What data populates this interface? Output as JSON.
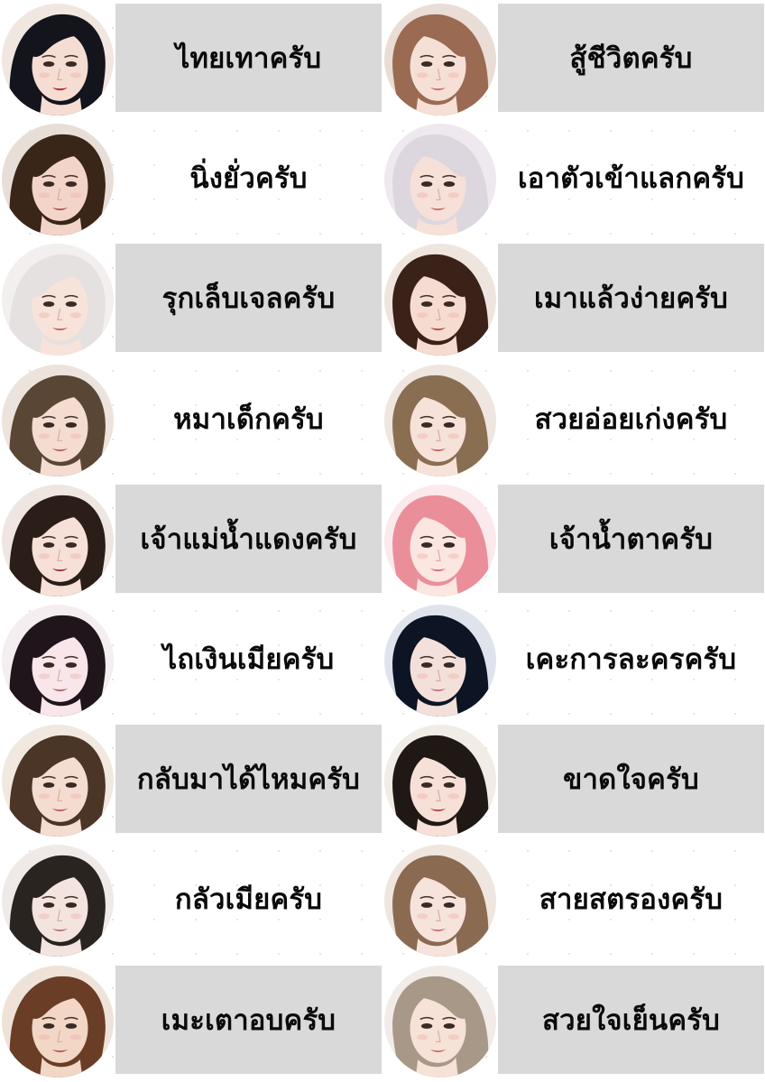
{
  "items": [
    {
      "label": "ไทยเทาครับ",
      "shaded": true,
      "icon": "avatar-icon",
      "hair": "#14141c",
      "bg": "#f1e6e0",
      "skin": "#f6ddd3",
      "lip": "#b21f2a"
    },
    {
      "label": "สู้ชีวิตครับ",
      "shaded": true,
      "icon": "avatar-icon",
      "hair": "#9a6a52",
      "bg": "#e9ddd6",
      "skin": "#f6e0d6",
      "lip": "#c86a6a"
    },
    {
      "label": "นิ่งยั่วครับ",
      "shaded": false,
      "icon": "avatar-icon",
      "hair": "#3a2618",
      "bg": "#e8ded8",
      "skin": "#f2d5c8",
      "lip": "#b3504f"
    },
    {
      "label": "เอาตัวเข้าแลกครับ",
      "shaded": false,
      "icon": "avatar-icon",
      "hair": "#dcd6df",
      "bg": "#efe9ef",
      "skin": "#f6e0d8",
      "lip": "#c56a70"
    },
    {
      "label": "รุกเล็บเจลครับ",
      "shaded": true,
      "icon": "avatar-icon",
      "hair": "#e4e1e0",
      "bg": "#f2efee",
      "skin": "#f7e3da",
      "lip": "#c0605c"
    },
    {
      "label": "เมาแล้วง่ายครับ",
      "shaded": true,
      "icon": "avatar-icon",
      "hair": "#3a2219",
      "bg": "#efe5df",
      "skin": "#f6dcd0",
      "lip": "#b84444"
    },
    {
      "label": "หมาเด็กครับ",
      "shaded": false,
      "icon": "avatar-icon",
      "hair": "#5a4634",
      "bg": "#ece3dc",
      "skin": "#f4dcd1",
      "lip": "#c25a5a"
    },
    {
      "label": "สวยอ่อยเก่งครับ",
      "shaded": false,
      "icon": "avatar-icon",
      "hair": "#8a6e52",
      "bg": "#eee6df",
      "skin": "#f6e2d8",
      "lip": "#c95e66"
    },
    {
      "label": "เจ้าแม่น้ำแดงครับ",
      "shaded": true,
      "icon": "avatar-icon",
      "hair": "#2b1d18",
      "bg": "#efe6e2",
      "skin": "#f6e0d8",
      "lip": "#9a2a36"
    },
    {
      "label": "เจ้าน้ำตาครับ",
      "shaded": true,
      "icon": "avatar-icon",
      "hair": "#ea8f9a",
      "bg": "#fbe9ec",
      "skin": "#fbe6e2",
      "lip": "#d66a76"
    },
    {
      "label": "ไถเงินเมียครับ",
      "shaded": false,
      "icon": "avatar-icon",
      "hair": "#20151a",
      "bg": "#f4eef0",
      "skin": "#f8e6ea",
      "lip": "#b65a6e"
    },
    {
      "label": "เคะการละครครับ",
      "shaded": false,
      "icon": "avatar-icon",
      "hair": "#0d1424",
      "bg": "#dfe4ec",
      "skin": "#f4e0da",
      "lip": "#c8707a"
    },
    {
      "label": "กลับมาได้ไหมครับ",
      "shaded": true,
      "icon": "avatar-icon",
      "hair": "#4a3526",
      "bg": "#f1e8e0",
      "skin": "#f4dcd0",
      "lip": "#c05a5a"
    },
    {
      "label": "ขาดใจครับ",
      "shaded": true,
      "icon": "avatar-icon",
      "hair": "#1f1814",
      "bg": "#f2ece6",
      "skin": "#f6e0d8",
      "lip": "#b8404c"
    },
    {
      "label": "กลัวเมียครับ",
      "shaded": false,
      "icon": "avatar-icon",
      "hair": "#2a2420",
      "bg": "#efeae8",
      "skin": "#f4e4e0",
      "lip": "#c07070"
    },
    {
      "label": "สายสตรองครับ",
      "shaded": false,
      "icon": "avatar-icon",
      "hair": "#8b6a52",
      "bg": "#efe6df",
      "skin": "#f6e4dc",
      "lip": "#c87070"
    },
    {
      "label": "เมะเตาอบครับ",
      "shaded": true,
      "icon": "avatar-icon",
      "hair": "#6a3e26",
      "bg": "#efe2d8",
      "skin": "#f2d6c6",
      "lip": "#b85a50"
    },
    {
      "label": "สวยใจเย็นครับ",
      "shaded": true,
      "icon": "avatar-icon",
      "hair": "#a89888",
      "bg": "#f1ece8",
      "skin": "#f6e2d6",
      "lip": "#c47070"
    }
  ]
}
